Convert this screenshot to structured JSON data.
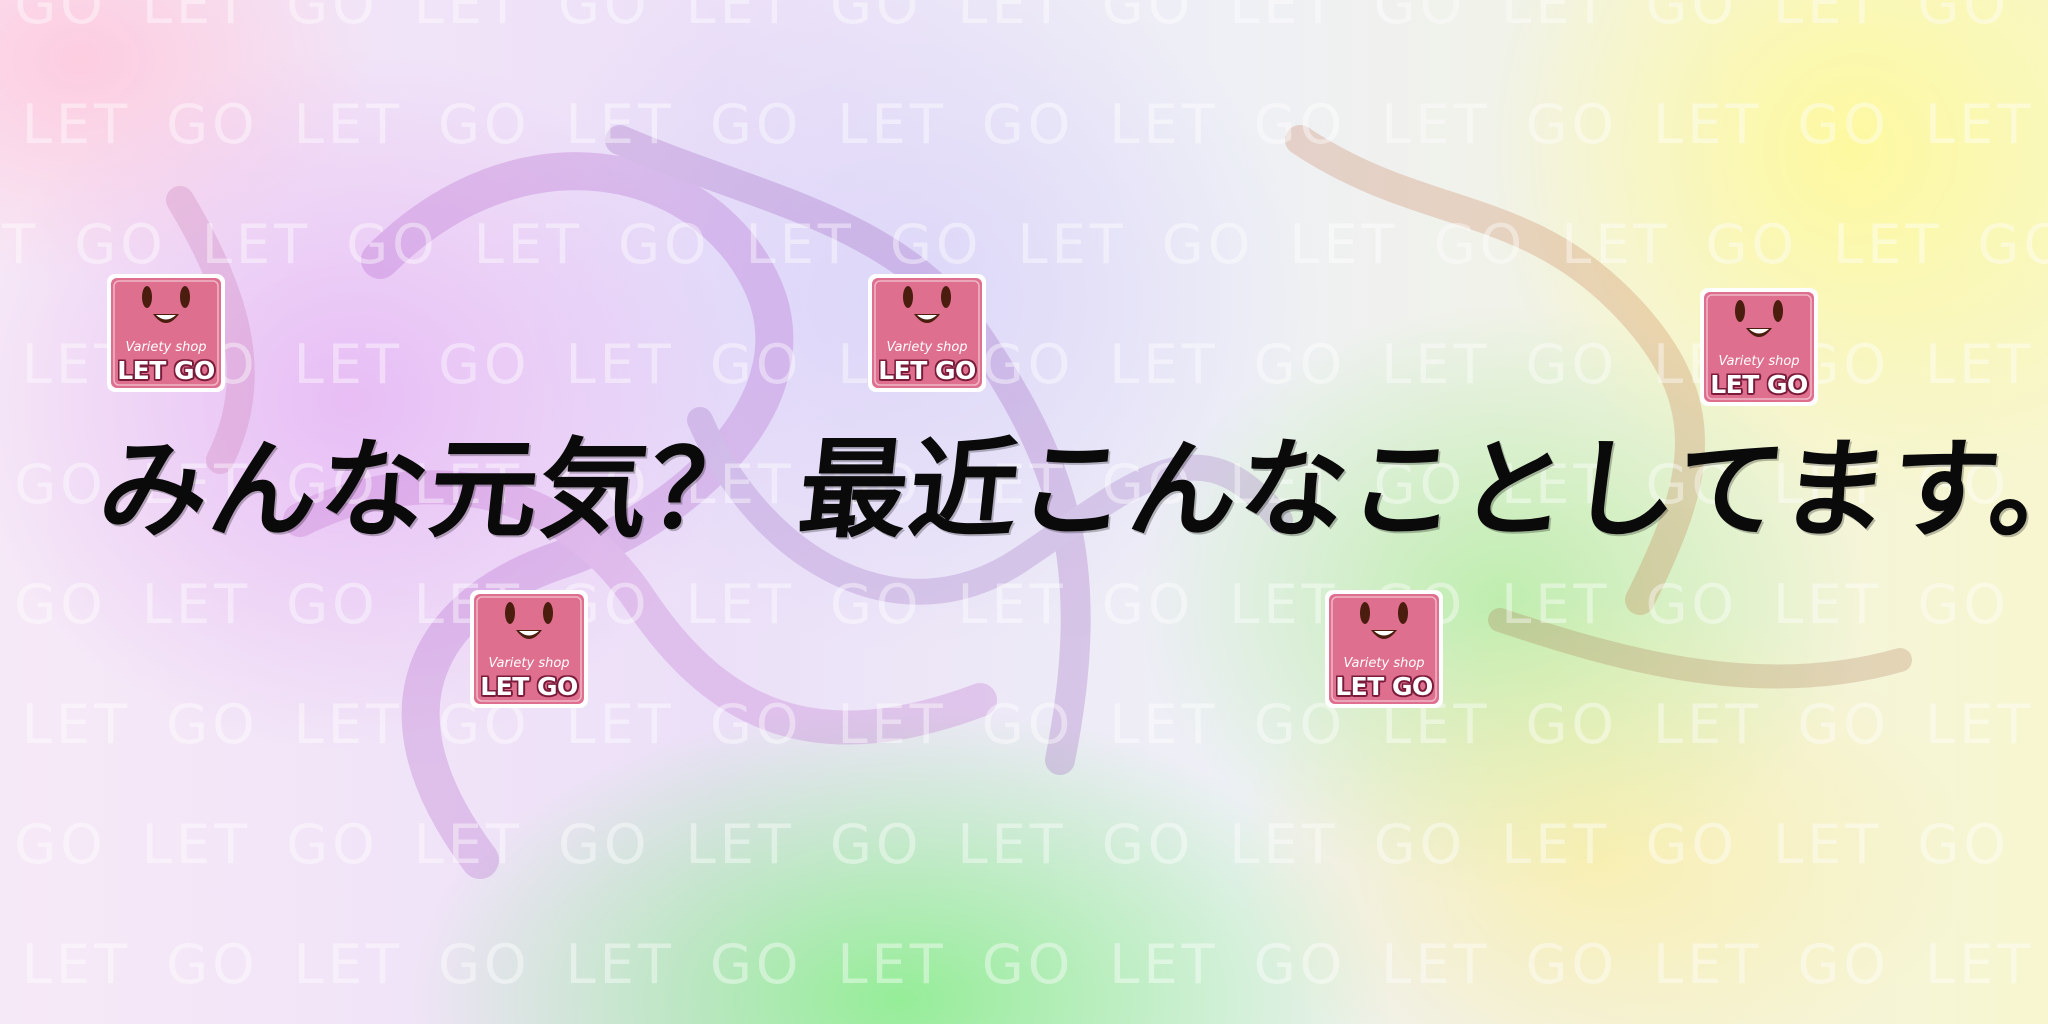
{
  "headline": "みんな元気？ 最近こんなことしてます。",
  "watermark": {
    "text": "LET GO",
    "color": "#ffffff"
  },
  "logo": {
    "icon": "smiling-square-face-icon",
    "subtitle": "Variety shop",
    "name": "LET GO",
    "color": "#df6f8e",
    "border_color": "#ffffff"
  },
  "colors": {
    "headline": "#0a0a0a",
    "background_pink": "#f6d0e2",
    "background_purple": "#e4b0f4",
    "background_green": "#9ef09c",
    "background_yellow": "#fff89a"
  }
}
